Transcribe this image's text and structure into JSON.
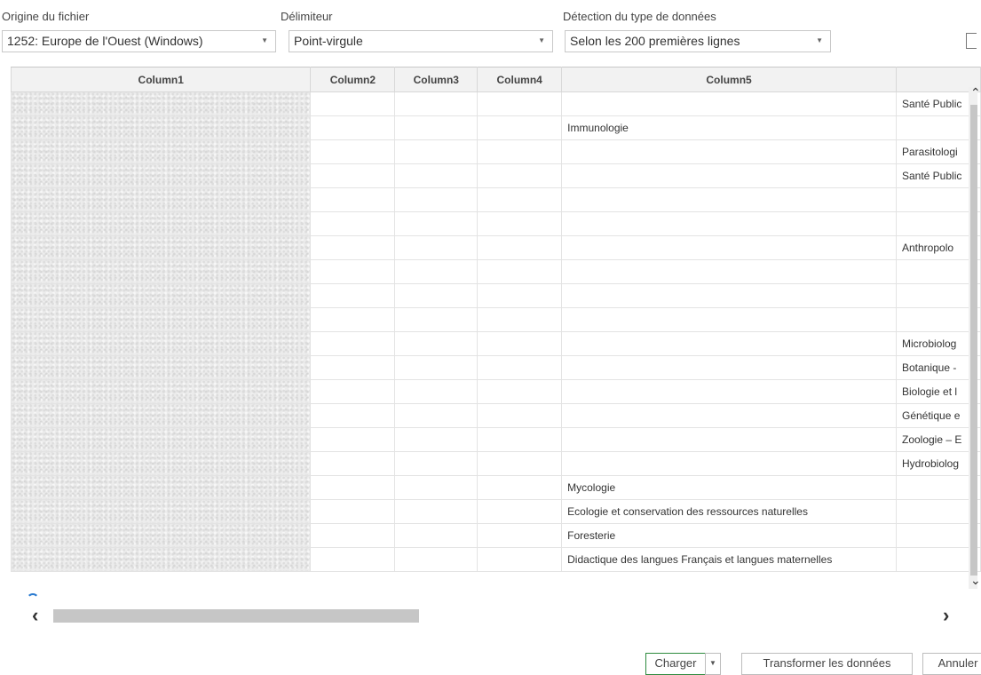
{
  "options": {
    "file_origin": {
      "label": "Origine du fichier",
      "value": "1252: Europe de l'Ouest (Windows)"
    },
    "delimiter": {
      "label": "Délimiteur",
      "value": "Point-virgule"
    },
    "type_detection": {
      "label": "Détection du type de données",
      "value": "Selon les 200 premières lignes"
    }
  },
  "table": {
    "columns": [
      "Column1",
      "Column2",
      "Column3",
      "Column4",
      "Column5",
      ""
    ],
    "column5": [
      "",
      "Immunologie",
      "",
      "",
      "",
      "",
      "",
      "",
      "",
      "",
      "",
      "",
      "",
      "",
      "",
      "",
      "Mycologie",
      "Ecologie et conservation des ressources naturelles",
      "Foresterie",
      "Didactique des langues Français et langues maternelles"
    ],
    "column6": [
      "Santé Public",
      "",
      "Parasitologi",
      "Santé Public",
      "",
      "",
      "Anthropolo",
      "",
      "",
      "",
      "Microbiolog",
      "Botanique -",
      "Biologie et l",
      "Génétique e",
      "Zoologie – E",
      "Hydrobiolog",
      "",
      "",
      "",
      ""
    ]
  },
  "footer": {
    "load": "Charger",
    "transform": "Transformer les données",
    "cancel": "Annuler"
  }
}
